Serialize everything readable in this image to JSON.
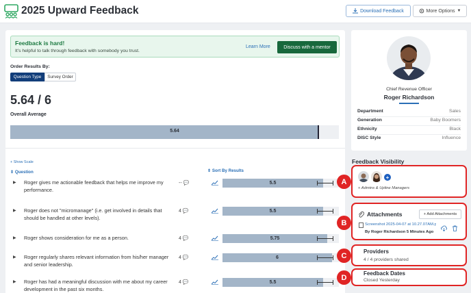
{
  "header": {
    "title": "2025 Upward Feedback",
    "download_label": "Download Feedback",
    "more_label": "More Options"
  },
  "alert": {
    "title": "Feedback is hard!",
    "text": "It's helpful to talk through feedback with somebody you trust.",
    "learn_more": "Learn More",
    "mentor_button": "Discuss with a mentor"
  },
  "order": {
    "label": "Order Results By:",
    "options": [
      "Question Type",
      "Survey Order"
    ],
    "selected": "Question Type"
  },
  "summary": {
    "score": "5.64 / 6",
    "label": "Overall Average",
    "value": "5.64",
    "fill_fraction": 0.94
  },
  "table": {
    "show_scale": "+ Show Scale",
    "question_header": "Question",
    "sort_header": "Sort By Results",
    "rows": [
      {
        "question": "Roger gives me actionable feedback that helps me improve my performance.",
        "count": "--",
        "value": "5.5",
        "fraction": 0.917
      },
      {
        "question": "Roger does not \"micromanage\" (i.e. get involved in details that should be handled at other levels).",
        "count": "4",
        "value": "5.5",
        "fraction": 0.917
      },
      {
        "question": "Roger shows consideration for me as a person.",
        "count": "4",
        "value": "5.75",
        "fraction": 0.958
      },
      {
        "question": "Roger regularly shares relevant information from his/her manager and senior leadership.",
        "count": "4",
        "value": "6",
        "fraction": 1.0
      },
      {
        "question": "Roger has had a meaningful discussion with me about my career development in the past six months.",
        "count": "4",
        "value": "5.5",
        "fraction": 0.917
      }
    ]
  },
  "profile": {
    "role": "Chief Revenue Officer",
    "name": "Roger Richardson",
    "attributes": [
      {
        "key": "Department",
        "value": "Sales"
      },
      {
        "key": "Generation",
        "value": "Baby Boomers"
      },
      {
        "key": "Ethnicity",
        "value": "Black"
      },
      {
        "key": "DISC Style",
        "value": "Influence"
      }
    ]
  },
  "visibility": {
    "title": "Feedback Visibility",
    "note": "+ Admins & Upline Managers",
    "marker": "A"
  },
  "attachments": {
    "title": "Attachments",
    "add_label": "+ Add Attachments",
    "file_name": "Screenshot 2025-04-07 at 10.27.07AM.png",
    "file_by": "By Roger Richardson 5 Minutes Ago",
    "marker": "B"
  },
  "providers": {
    "title": "Providers",
    "subtitle": "4 / 4 providers shared",
    "marker": "C"
  },
  "feedback_dates": {
    "title": "Feedback Dates",
    "subtitle": "Closed Yesterday",
    "marker": "D"
  },
  "colors": {
    "accent": "#2a6fb6",
    "mentor_green": "#17683c",
    "bar_fill": "#a3b5c8",
    "highlight_red": "#e02424"
  }
}
